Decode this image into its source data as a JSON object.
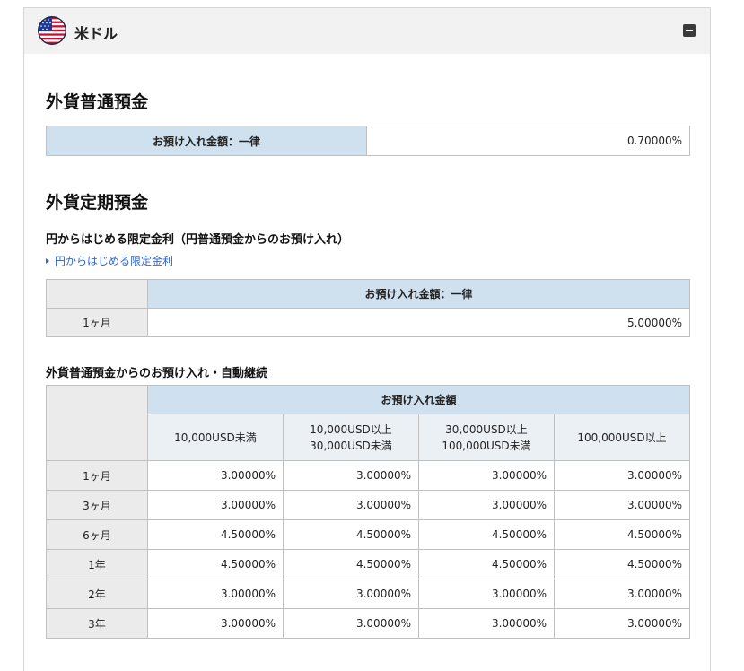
{
  "header": {
    "flag_icon": "us-flag-icon",
    "currency_name": "米ドル",
    "collapse_icon": "collapse-minus-icon"
  },
  "ordinary": {
    "title": "外貨普通預金",
    "label": "お預け入れ金額：一律",
    "rate": "0.70000%"
  },
  "fixed": {
    "title": "外貨定期預金",
    "limited": {
      "heading": "円からはじめる限定金利（円普通預金からのお預け入れ）",
      "link": "円からはじめる限定金利",
      "column_header": "お預け入れ金額：一律",
      "rows": [
        {
          "term": "1ヶ月",
          "rate": "5.00000%"
        }
      ]
    },
    "auto": {
      "heading": "外貨普通預金からのお預け入れ・自動継続",
      "group_header": "お預け入れ金額",
      "columns": [
        [
          "10,000USD未満"
        ],
        [
          "10,000USD以上",
          "30,000USD未満"
        ],
        [
          "30,000USD以上",
          "100,000USD未満"
        ],
        [
          "100,000USD以上"
        ]
      ],
      "rows": [
        {
          "term": "1ヶ月",
          "rates": [
            "3.00000%",
            "3.00000%",
            "3.00000%",
            "3.00000%"
          ]
        },
        {
          "term": "3ヶ月",
          "rates": [
            "3.00000%",
            "3.00000%",
            "3.00000%",
            "3.00000%"
          ]
        },
        {
          "term": "6ヶ月",
          "rates": [
            "4.50000%",
            "4.50000%",
            "4.50000%",
            "4.50000%"
          ]
        },
        {
          "term": "1年",
          "rates": [
            "4.50000%",
            "4.50000%",
            "4.50000%",
            "4.50000%"
          ]
        },
        {
          "term": "2年",
          "rates": [
            "3.00000%",
            "3.00000%",
            "3.00000%",
            "3.00000%"
          ]
        },
        {
          "term": "3年",
          "rates": [
            "3.00000%",
            "3.00000%",
            "3.00000%",
            "3.00000%"
          ]
        }
      ]
    }
  },
  "colors": {
    "header_blue": "#cfe0ee",
    "row_header_gray": "#ebebeb",
    "link_blue": "#3366cc"
  }
}
